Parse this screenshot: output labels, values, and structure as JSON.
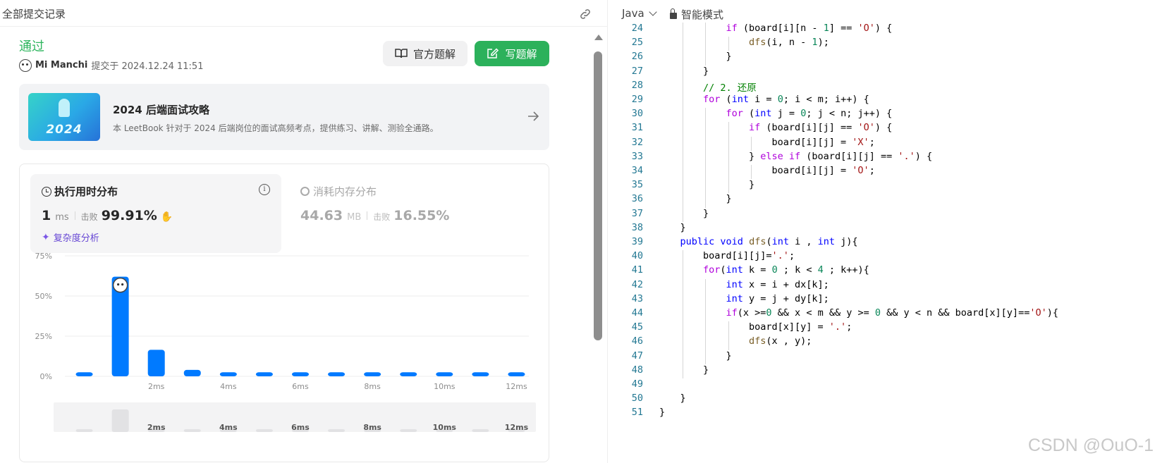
{
  "left": {
    "header_title": "全部提交记录",
    "status": "通过",
    "submitter_name": "Mi Manchi",
    "submitted_at": "提交于 2024.12.24 11:51",
    "official_solution_label": "官方题解",
    "write_solution_label": "写题解",
    "book": {
      "cover_year": "2024",
      "title": "2024 后端面试攻略",
      "description": "本 LeetBook 针对于 2024 后端岗位的面试高频考点，提供练习、讲解、测验全通路。"
    },
    "runtime": {
      "title": "执行用时分布",
      "value": "1",
      "unit": "ms",
      "beat_label": "击败",
      "beat_percent": "99.91%",
      "complexity_label": "复杂度分析"
    },
    "memory": {
      "title": "消耗内存分布",
      "value": "44.63",
      "unit": "MB",
      "beat_label": "击败",
      "beat_percent": "16.55%"
    }
  },
  "chart_data": {
    "type": "bar",
    "ytick_labels": [
      "75%",
      "50%",
      "25%",
      "0%"
    ],
    "yticks": [
      75,
      50,
      25,
      0
    ],
    "ylim": [
      0,
      75
    ],
    "xtick_labels": [
      "2ms",
      "4ms",
      "6ms",
      "8ms",
      "10ms",
      "12ms"
    ],
    "xtick_positions": [
      2,
      4,
      6,
      8,
      10,
      12
    ],
    "categories": [
      0,
      1,
      2,
      3,
      4,
      5,
      6,
      7,
      8,
      9,
      10,
      11,
      12
    ],
    "values": [
      2.5,
      62,
      16.5,
      4,
      2.5,
      2.5,
      2.5,
      2.5,
      2.5,
      2.5,
      2.5,
      2.5,
      2.5
    ],
    "highlight_index": 1,
    "bar_color": "#007aff",
    "grid": true,
    "minimap_values": [
      1,
      14,
      1,
      1,
      1,
      1,
      1,
      1,
      1,
      1,
      1,
      1,
      1
    ]
  },
  "right": {
    "language": "Java",
    "mode_label": "智能模式"
  },
  "code_lines": [
    {
      "n": "24",
      "indent": 3,
      "html": "<span class=\"ctl\">if</span> (board[i][n - <span class=\"num\">1</span>] == <span class=\"str\">'O'</span>) {"
    },
    {
      "n": "25",
      "indent": 4,
      "html": "<span class=\"fn\">dfs</span>(i, n - <span class=\"num\">1</span>);"
    },
    {
      "n": "26",
      "indent": 3,
      "html": "}"
    },
    {
      "n": "27",
      "indent": 2,
      "html": "}"
    },
    {
      "n": "28",
      "indent": 2,
      "html": "<span class=\"cm\">// 2. 还原</span>"
    },
    {
      "n": "29",
      "indent": 2,
      "html": "<span class=\"ctl\">for</span> (<span class=\"kw\">int</span> i = <span class=\"num\">0</span>; i &lt; m; i++) {"
    },
    {
      "n": "30",
      "indent": 3,
      "html": "<span class=\"ctl\">for</span> (<span class=\"kw\">int</span> j = <span class=\"num\">0</span>; j &lt; n; j++) {"
    },
    {
      "n": "31",
      "indent": 4,
      "html": "<span class=\"ctl\">if</span> (board[i][j] == <span class=\"str\">'O'</span>) {"
    },
    {
      "n": "32",
      "indent": 5,
      "html": "board[i][j] = <span class=\"str\">'X'</span>;"
    },
    {
      "n": "33",
      "indent": 4,
      "html": "} <span class=\"ctl\">else if</span> (board[i][j] == <span class=\"str\">'.'</span>) {"
    },
    {
      "n": "34",
      "indent": 5,
      "html": "board[i][j] = <span class=\"str\">'O'</span>;"
    },
    {
      "n": "35",
      "indent": 4,
      "html": "}"
    },
    {
      "n": "36",
      "indent": 3,
      "html": "}"
    },
    {
      "n": "37",
      "indent": 2,
      "html": "}"
    },
    {
      "n": "38",
      "indent": 1,
      "html": "}"
    },
    {
      "n": "39",
      "indent": 1,
      "html": "<span class=\"kw\">public</span> <span class=\"kw\">void</span> <span class=\"fn\">dfs</span>(<span class=\"kw\">int</span> i , <span class=\"kw\">int</span> j){"
    },
    {
      "n": "40",
      "indent": 2,
      "html": "board[i][j]=<span class=\"str\">'.'</span>;"
    },
    {
      "n": "41",
      "indent": 2,
      "html": "<span class=\"ctl\">for</span>(<span class=\"kw\">int</span> k = <span class=\"num\">0</span> ; k &lt; <span class=\"num\">4</span> ; k++){"
    },
    {
      "n": "42",
      "indent": 3,
      "html": "<span class=\"kw\">int</span> x = i + dx[k];"
    },
    {
      "n": "43",
      "indent": 3,
      "html": "<span class=\"kw\">int</span> y = j + dy[k];"
    },
    {
      "n": "44",
      "indent": 3,
      "html": "<span class=\"ctl\">if</span>(x &gt;=<span class=\"num\">0</span> &amp;&amp; x &lt; m &amp;&amp; y &gt;= <span class=\"num\">0</span> &amp;&amp; y &lt; n &amp;&amp; board[x][y]==<span class=\"str\">'O'</span>){"
    },
    {
      "n": "45",
      "indent": 4,
      "html": "board[x][y] = <span class=\"str\">'.'</span>;"
    },
    {
      "n": "46",
      "indent": 4,
      "html": "<span class=\"fn\">dfs</span>(x , y);"
    },
    {
      "n": "47",
      "indent": 3,
      "html": "}"
    },
    {
      "n": "48",
      "indent": 2,
      "html": "}"
    },
    {
      "n": "49",
      "indent": 1,
      "html": ""
    },
    {
      "n": "50",
      "indent": 1,
      "html": "}"
    },
    {
      "n": "51",
      "indent": 0,
      "html": "}"
    }
  ],
  "watermark": "CSDN @OuO-1"
}
